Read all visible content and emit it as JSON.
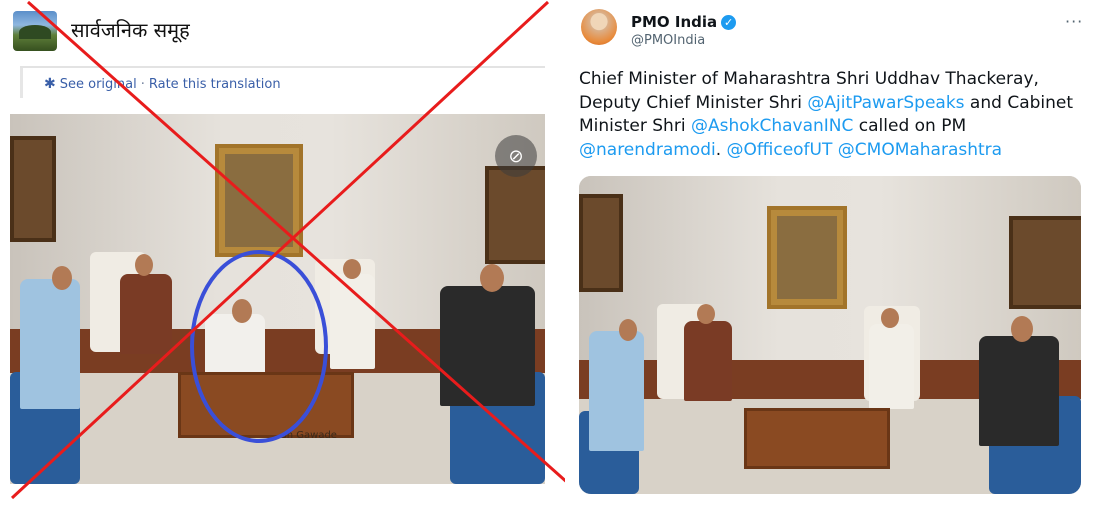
{
  "left_panel": {
    "group_name": "सार्वजनिक समूह",
    "see_original": "See original",
    "separator": "·",
    "rate_translation": "Rate this translation",
    "settings_icon": "gear-icon",
    "view_icon": "eye-slash-icon",
    "photo_caption": "...sh Gawade"
  },
  "right_panel": {
    "account_name": "PMO India",
    "account_handle": "@PMOIndia",
    "more_label": "···",
    "tweet_parts": {
      "p1": "Chief Minister of Maharashtra Shri Uddhav Thackeray, Deputy Chief Minister Shri ",
      "m1": "@AjitPawarSpeaks",
      "p2": " and Cabinet Minister Shri ",
      "m2": "@AshokChavanINC",
      "p3": " called on PM ",
      "m3": "@narendramodi",
      "p4": ". ",
      "m4": "@OfficeofUT",
      "p5": " ",
      "m5": "@CMOMaharashtra"
    }
  },
  "colors": {
    "mention": "#1d9bf0",
    "cross": "#e81c1c",
    "circle": "#3a4fd8",
    "fb_link": "#3a5fa8"
  }
}
